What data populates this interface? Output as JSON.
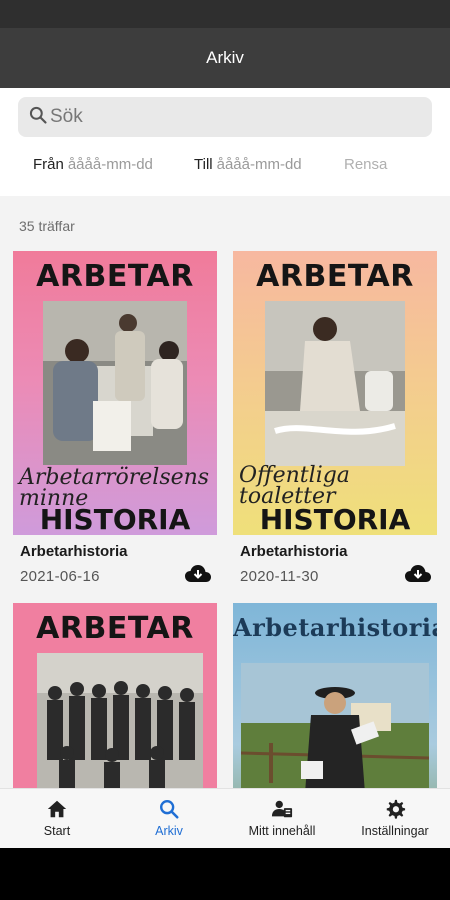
{
  "app_bar": {
    "title": "Arkiv"
  },
  "search": {
    "placeholder": "Sök",
    "icon": "search-icon"
  },
  "date_filter": {
    "from_label": "Från",
    "from_placeholder": "åååå-mm-dd",
    "to_label": "Till",
    "to_placeholder": "åååå-mm-dd",
    "clear_label": "Rensa"
  },
  "results": {
    "count_text": "35 träffar",
    "items": [
      {
        "title": "Arbetarhistoria",
        "date": "2021-06-16",
        "cover_top": "ARBETAR",
        "cover_script": "Arbetarrörelsens minne",
        "cover_bottom": "HISTORIA"
      },
      {
        "title": "Arbetarhistoria",
        "date": "2020-11-30",
        "cover_top": "ARBETAR",
        "cover_script": "Offentliga toaletter",
        "cover_bottom": "HISTORIA"
      },
      {
        "title": "",
        "date": "",
        "cover_top": "ARBETAR"
      },
      {
        "title": "",
        "date": "",
        "cover_top": "Arbetarhistoria"
      }
    ]
  },
  "bottom_nav": [
    {
      "label": "Start",
      "icon": "home-icon"
    },
    {
      "label": "Arkiv",
      "icon": "search-icon"
    },
    {
      "label": "Mitt innehåll",
      "icon": "user-content-icon"
    },
    {
      "label": "Inställningar",
      "icon": "gear-icon"
    }
  ],
  "colors": {
    "app_bar": "#3d3d3d",
    "accent": "#1f6ed4"
  }
}
